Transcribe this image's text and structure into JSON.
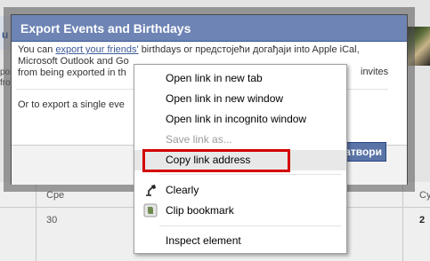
{
  "background": {
    "header_initial": "u",
    "left_text_lines": [
      "ром",
      "from"
    ],
    "calendar": {
      "col1_header": "Сре",
      "col1_date": "30",
      "right_header": "Су",
      "right_date": "2"
    }
  },
  "dialog": {
    "title": "Export Events and Birthdays",
    "body_line1_prefix": "You can",
    "body_line1_link": "export your friends'",
    "body_line1_suffix": "birthdays or предстојећи догађаји into Apple iCal,",
    "body_line2": "Microsoft Outlook and Go",
    "body_line3": "from being exported in th",
    "right_hint_1": "invites",
    "line2": "Or to export a single eve",
    "close_button": "Затвори"
  },
  "context_menu": {
    "items": [
      {
        "label": "Open link in new tab",
        "enabled": true
      },
      {
        "label": "Open link in new window",
        "enabled": true
      },
      {
        "label": "Open link in incognito window",
        "enabled": true
      },
      {
        "label": "Save link as...",
        "enabled": false
      },
      {
        "label": "Copy link address",
        "enabled": true,
        "highlighted": true
      },
      {
        "label": "Clearly",
        "enabled": true,
        "icon": "clearly-lamp-icon"
      },
      {
        "label": "Clip bookmark",
        "enabled": true,
        "icon": "evernote-clip-icon"
      },
      {
        "label": "Inspect element",
        "enabled": true
      }
    ]
  },
  "colors": {
    "title_bar": "#6d84b4",
    "link": "#3b5998",
    "highlight_box": "#d40000"
  }
}
